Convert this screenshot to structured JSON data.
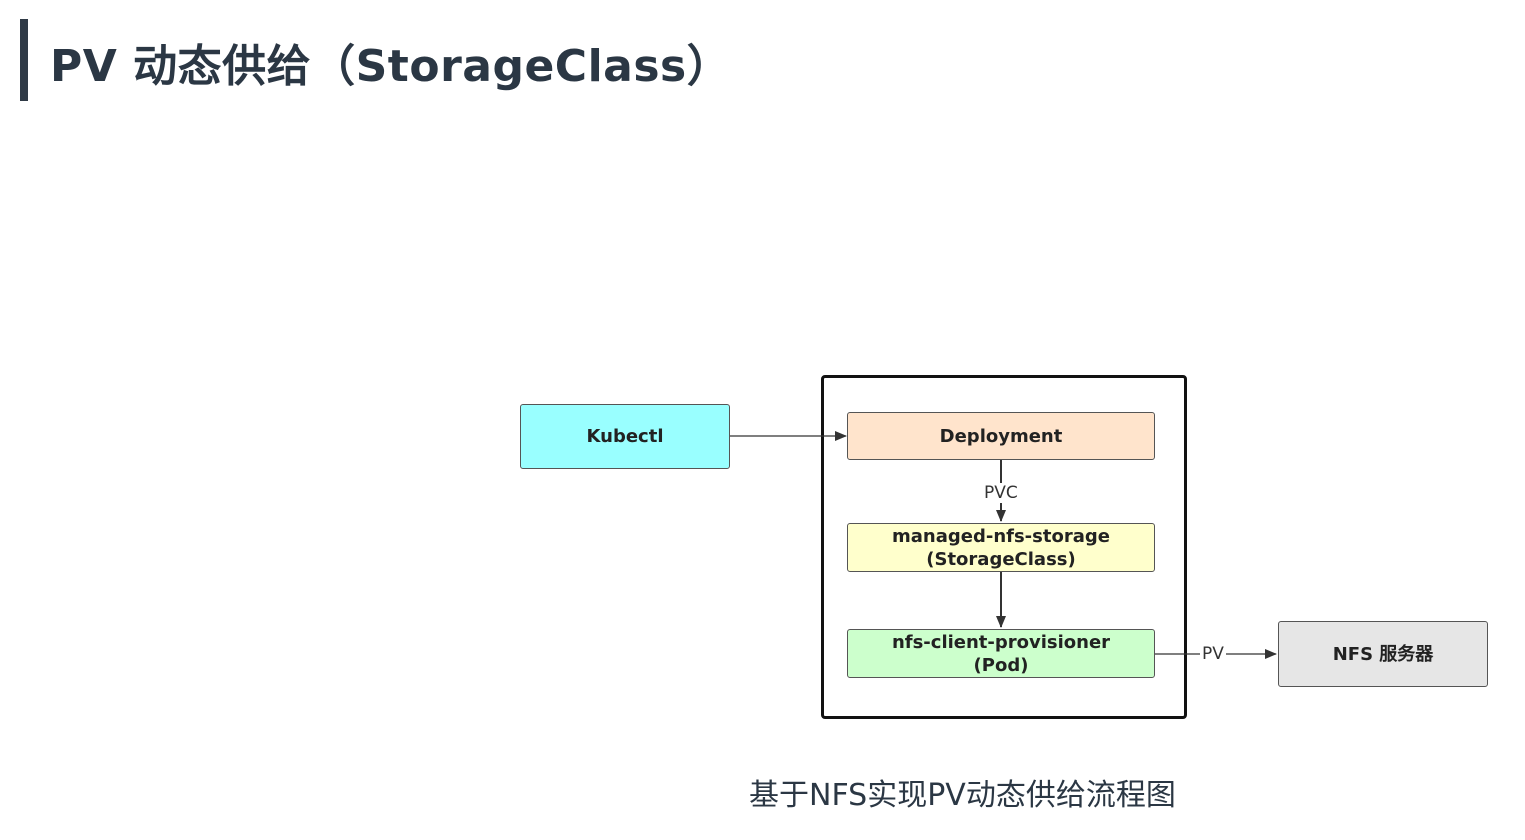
{
  "page": {
    "title": "PV 动态供给（StorageClass）"
  },
  "diagram": {
    "nodes": {
      "kubectl": {
        "label": "Kubectl",
        "fill": "#99ffff"
      },
      "deployment": {
        "label": "Deployment",
        "fill": "#ffe4cc"
      },
      "storageclass": {
        "line1": "managed-nfs-storage",
        "line2": "(StorageClass)",
        "fill": "#ffffcc"
      },
      "provisioner": {
        "line1": "nfs-client-provisioner",
        "line2": "(Pod)",
        "fill": "#ccffcc"
      },
      "nfs_server": {
        "label": "NFS 服务器",
        "fill": "#e6e6e6"
      }
    },
    "edges": {
      "pvc_label": "PVC",
      "pv_label": "PV"
    },
    "caption": "基于NFS实现PV动态供给流程图"
  },
  "colors": {
    "title_text": "#2b3744",
    "title_bar": "#2f3a46",
    "border": "#555555",
    "container_border": "#111111"
  }
}
